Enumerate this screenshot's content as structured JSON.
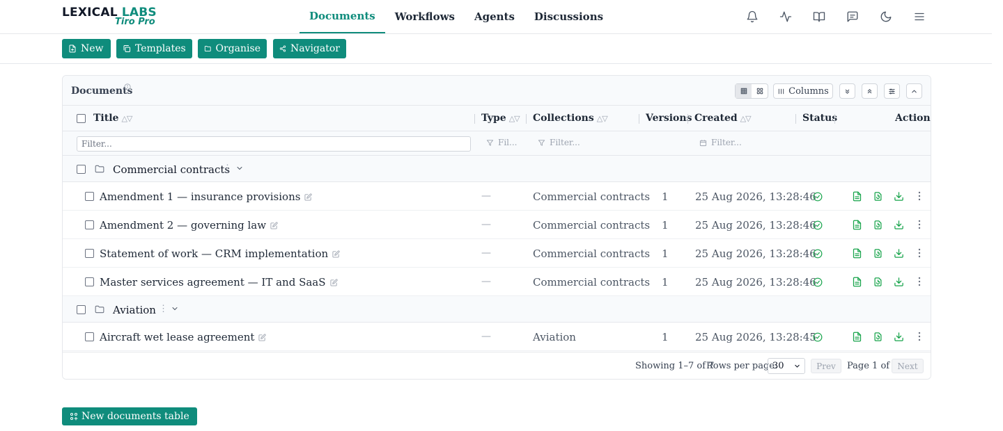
{
  "brand": {
    "name_main": "LEXICAL ",
    "name_accent": "LABS",
    "product": "Tiro Pro"
  },
  "nav": {
    "documents": "Documents",
    "workflows": "Workflows",
    "agents": "Agents",
    "discussions": "Discussions",
    "active": "Documents"
  },
  "top_icons": [
    "bell-icon",
    "activity-icon",
    "book-icon",
    "chat-icon",
    "moon-icon",
    "menu-icon"
  ],
  "toolbar": {
    "new": "New",
    "templates": "Templates",
    "organise": "Organise",
    "navigator": "Navigator"
  },
  "panel": {
    "title": "Documents",
    "columns_button": "Columns"
  },
  "table": {
    "headers": {
      "title": "Title",
      "type": "Type",
      "collections": "Collections",
      "versions": "Versions",
      "created": "Created",
      "status": "Status",
      "actions": "Actions"
    },
    "sort_glyph": "△▽",
    "filters": {
      "title_placeholder": "Filter...",
      "type_placeholder": "Fil...",
      "collections_placeholder": "Filter...",
      "created_placeholder": "Filter..."
    },
    "groups": [
      {
        "name": "Commercial contracts",
        "rows": [
          {
            "title": "Amendment 1 — insurance provisions",
            "type": "—",
            "collection": "Commercial contracts",
            "versions": "1",
            "created": "25 Aug 2026, 13:28:46"
          },
          {
            "title": "Amendment 2 — governing law",
            "type": "—",
            "collection": "Commercial contracts",
            "versions": "1",
            "created": "25 Aug 2026, 13:28:46"
          },
          {
            "title": "Statement of work — CRM implementation",
            "type": "—",
            "collection": "Commercial contracts",
            "versions": "1",
            "created": "25 Aug 2026, 13:28:46"
          },
          {
            "title": "Master services agreement — IT and SaaS",
            "type": "—",
            "collection": "Commercial contracts",
            "versions": "1",
            "created": "25 Aug 2026, 13:28:46"
          }
        ]
      },
      {
        "name": "Aviation",
        "rows": [
          {
            "title": "Aircraft wet lease agreement",
            "type": "—",
            "collection": "Aviation",
            "versions": "1",
            "created": "25 Aug 2026, 13:28:45"
          }
        ]
      }
    ]
  },
  "footer": {
    "showing": "Showing 1–7 of 7",
    "rows_per_page_label": "Rows per page:",
    "rows_per_page": "30",
    "prev": "Prev",
    "page": "Page 1 of 1",
    "next": "Next"
  },
  "bottom": {
    "new_table": "New documents table"
  },
  "colors": {
    "accent": "#0f8c7c",
    "status_ok": "#16a34a"
  }
}
